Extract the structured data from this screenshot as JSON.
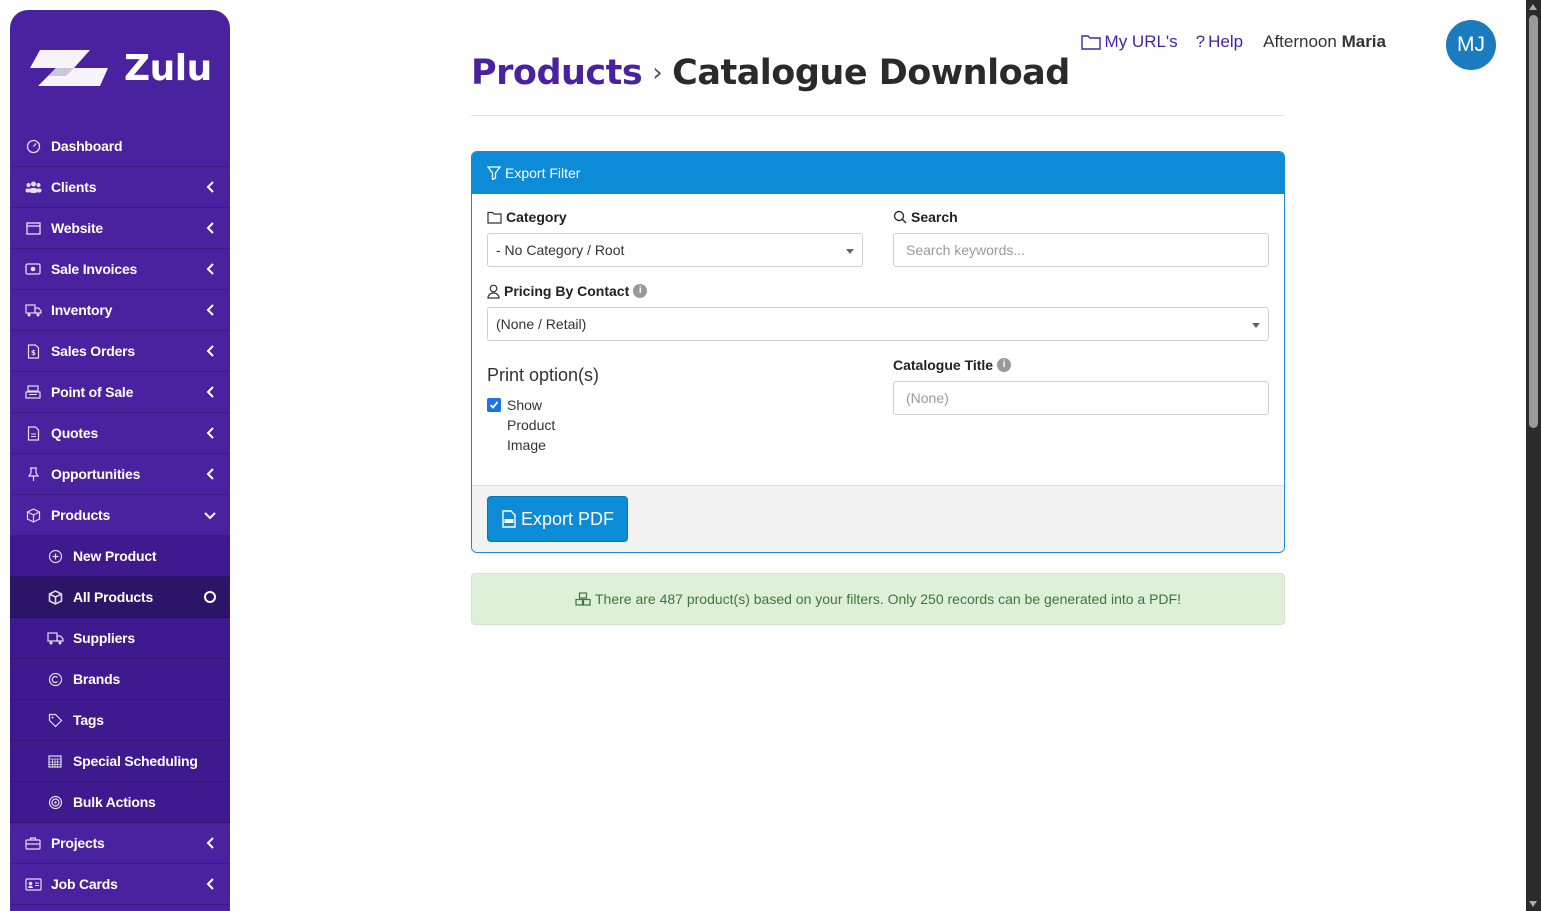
{
  "app": {
    "name": "Zulu"
  },
  "sidebar": {
    "items": [
      {
        "label": "Dashboard",
        "icon": "dashboard-icon",
        "chevron": ""
      },
      {
        "label": "Clients",
        "icon": "users-icon",
        "chevron": "left"
      },
      {
        "label": "Website",
        "icon": "window-icon",
        "chevron": "left"
      },
      {
        "label": "Sale Invoices",
        "icon": "money-icon",
        "chevron": "left"
      },
      {
        "label": "Inventory",
        "icon": "truck-icon",
        "chevron": "left"
      },
      {
        "label": "Sales Orders",
        "icon": "invoice-icon",
        "chevron": "left"
      },
      {
        "label": "Point of Sale",
        "icon": "register-icon",
        "chevron": "left"
      },
      {
        "label": "Quotes",
        "icon": "document-icon",
        "chevron": "left"
      },
      {
        "label": "Opportunities",
        "icon": "pin-icon",
        "chevron": "left"
      },
      {
        "label": "Products",
        "icon": "box-icon",
        "chevron": "down"
      }
    ],
    "products_sub": [
      {
        "label": "New Product",
        "icon": "plus-circle-icon"
      },
      {
        "label": "All Products",
        "icon": "cube-icon"
      },
      {
        "label": "Suppliers",
        "icon": "truck-icon"
      },
      {
        "label": "Brands",
        "icon": "copyright-icon"
      },
      {
        "label": "Tags",
        "icon": "tag-icon"
      },
      {
        "label": "Special Scheduling",
        "icon": "calendar-icon"
      },
      {
        "label": "Bulk Actions",
        "icon": "target-icon"
      }
    ],
    "after": [
      {
        "label": "Projects",
        "icon": "briefcase-icon"
      },
      {
        "label": "Job Cards",
        "icon": "id-card-icon"
      }
    ]
  },
  "header": {
    "my_urls": "My URL's",
    "help": "Help",
    "greeting": "Afternoon",
    "user_first_name": "Maria",
    "avatar_initials": "MJ"
  },
  "page": {
    "breadcrumb_parent": "Products",
    "breadcrumb_sep": "›",
    "title": "Catalogue Download"
  },
  "panel": {
    "heading": "Export Filter",
    "category_label": "Category",
    "category_value": "- No Category / Root",
    "search_label": "Search",
    "search_placeholder": "Search keywords...",
    "pricing_label": "Pricing By Contact",
    "pricing_value": "(None / Retail)",
    "print_title": "Print option(s)",
    "show_image_label": "Show Product Image",
    "show_image_checked": true,
    "catalogue_title_label": "Catalogue Title",
    "catalogue_title_placeholder": "(None)",
    "export_button": "Export PDF"
  },
  "alert": {
    "text": "There are 487 product(s) based on your filters. Only 250 records can be generated into a PDF!"
  },
  "colors": {
    "sidebar": "#4a22a0",
    "accent_blue": "#0c8bd6",
    "alert_bg": "#dff0d8",
    "alert_text": "#3c763d"
  }
}
